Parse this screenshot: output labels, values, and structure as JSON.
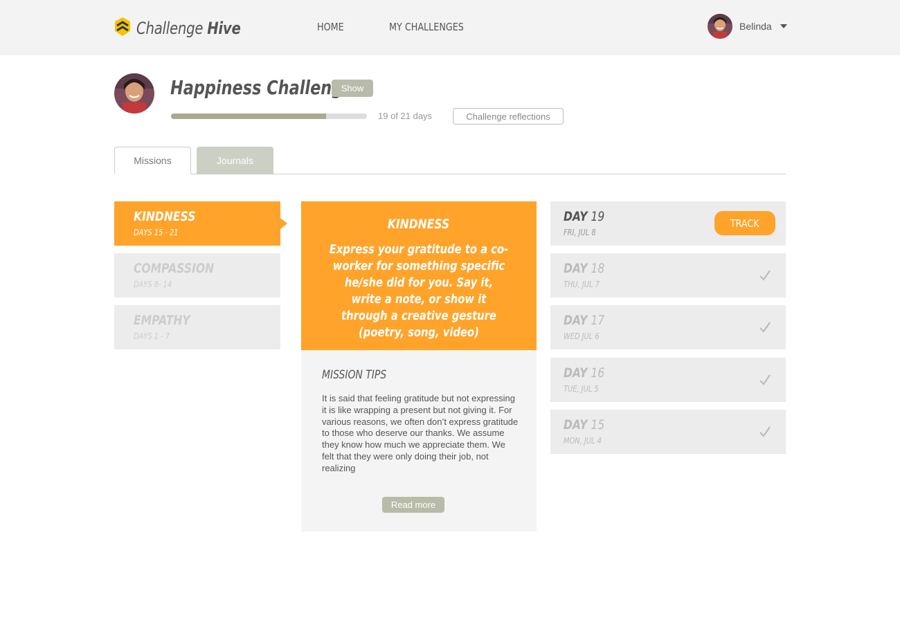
{
  "brand": {
    "name_light": "Challenge",
    "name_bold": "Hive",
    "logo_color": "#f2c500"
  },
  "nav": {
    "home": "HOME",
    "my_challenges": "MY CHALLENGES"
  },
  "user": {
    "name": "Belinda"
  },
  "challenge": {
    "title": "Happiness Challenge",
    "show_label": "Show",
    "progress_fraction": 0.7916,
    "progress_text": "19 of 21 days",
    "reflections_label": "Challenge reflections"
  },
  "tabs": {
    "missions": "Missions",
    "journals": "Journals"
  },
  "missions": [
    {
      "name": "KINDNESS",
      "days": "DAYS 15 - 21",
      "active": true
    },
    {
      "name": "COMPASSION",
      "days": "DAYS 8- 14",
      "active": false
    },
    {
      "name": "EMPATHY",
      "days": "DAYS 1 - 7",
      "active": false
    }
  ],
  "card": {
    "title": "KINDNESS",
    "description": "Express your gratitude to a co-worker for something specific he/she did for you. Say it, write a note, or show it through a creative gesture (poetry, song, video)",
    "tips_title": "MISSION TIPS",
    "tips_body": "It is said that feeling gratitude but not expressing it is like wrapping a present but not giving it. For various reasons, we often don’t express gratitude to those who deserve our thanks. We assume they know how much we appreciate them. We felt that they were only doing their job, not realizing",
    "read_more": "Read more"
  },
  "days": [
    {
      "word": "DAY",
      "num": "19",
      "date": "FRI, JUL 8",
      "current": true,
      "action": "TRACK"
    },
    {
      "word": "DAY",
      "num": "18",
      "date": "THU, JUL 7",
      "current": false
    },
    {
      "word": "DAY",
      "num": "17",
      "date": "WED JUL 6",
      "current": false
    },
    {
      "word": "DAY",
      "num": "16",
      "date": "TUE, JUL 5",
      "current": false
    },
    {
      "word": "DAY",
      "num": "15",
      "date": "MON, JUL 4",
      "current": false
    }
  ],
  "colors": {
    "accent": "#ffa32a",
    "muted_button": "#b8bba8",
    "progress": "#a9a892",
    "panel": "#ececec"
  }
}
